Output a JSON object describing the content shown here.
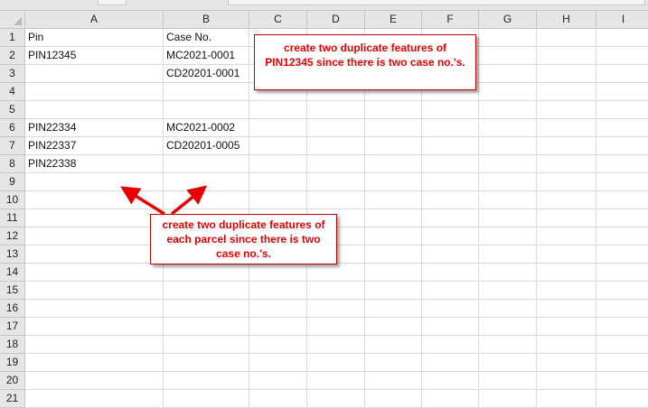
{
  "sheet": {
    "columns": [
      "A",
      "B",
      "C",
      "D",
      "E",
      "F",
      "G",
      "H",
      "I"
    ],
    "rows": [
      "1",
      "2",
      "3",
      "4",
      "5",
      "6",
      "7",
      "8",
      "9",
      "10",
      "11",
      "12",
      "13",
      "14",
      "15",
      "16",
      "17",
      "18",
      "19",
      "20",
      "21"
    ],
    "cells": {
      "A1": "Pin",
      "B1": "Case No.",
      "A2": "PIN12345",
      "B2": "MC2021-0001",
      "B3": "CD20201-0001",
      "A6": "PIN22334",
      "B6": "MC2021-0002",
      "A7": "PIN22337",
      "B7": "CD20201-0005",
      "A8": "PIN22338"
    }
  },
  "annotations": {
    "top_callout": "create two duplicate features of PIN12345 since there is two case no.'s.",
    "bottom_callout": "create two duplicate features of each parcel since there is two case no.'s.",
    "accent_color": "#e60000"
  }
}
